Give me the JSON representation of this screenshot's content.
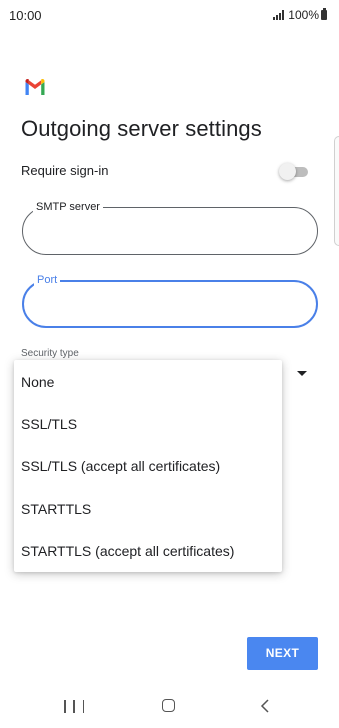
{
  "status_bar": {
    "time": "10:00",
    "battery": "100%"
  },
  "header": {
    "logo": "gmail-logo",
    "title": "Outgoing server settings"
  },
  "require_sign_in": {
    "label": "Require sign-in",
    "enabled": false
  },
  "fields": {
    "smtp_server": {
      "label": "SMTP server",
      "value": ""
    },
    "port": {
      "label": "Port",
      "value": "",
      "focused": true
    }
  },
  "security": {
    "label": "Security type",
    "options": [
      "None",
      "SSL/TLS",
      "SSL/TLS (accept all certificates)",
      "STARTTLS",
      "STARTTLS (accept all certificates)"
    ]
  },
  "actions": {
    "next_label": "NEXT"
  },
  "nav_bar": {
    "recents_icon": "recents-icon",
    "home_icon": "home-icon",
    "back_icon": "back-icon"
  },
  "colors": {
    "accent": "#4a80e8",
    "button": "#4a87f0",
    "gmail_red": "#ea4335",
    "gmail_blue": "#4285f4",
    "gmail_green": "#34a853",
    "gmail_yellow": "#fbbc04"
  }
}
